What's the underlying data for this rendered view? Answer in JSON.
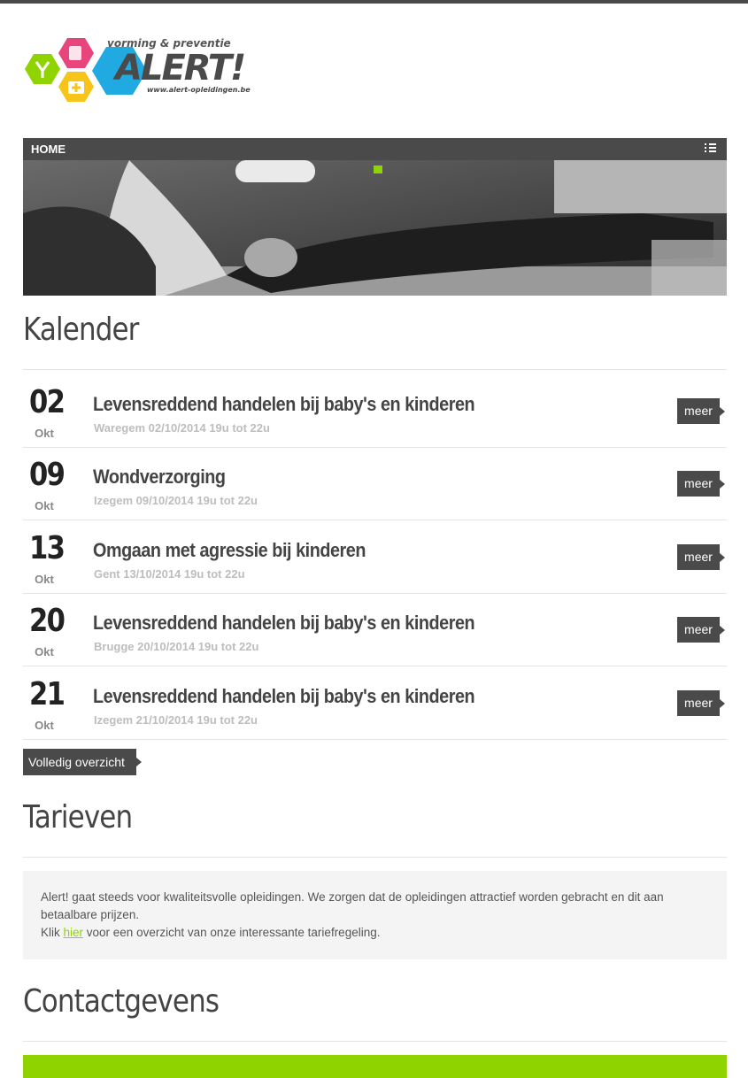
{
  "brand": {
    "tagline": "vorming & preventie",
    "wordmark": "ALERT!",
    "url": "www.alert-opleidingen.be",
    "colors": {
      "green": "#8fd400",
      "pink": "#e8457c",
      "blue": "#21a9e1",
      "yellow": "#f7c41a",
      "dark": "#4a4a4a"
    }
  },
  "nav": {
    "home": "HOME",
    "menu_icon": "list-icon"
  },
  "sections": {
    "kalender": "Kalender",
    "tarieven": "Tarieven",
    "contact": "Contactgevens"
  },
  "events": [
    {
      "day": "02",
      "month": "Okt",
      "title": "Levensreddend handelen bij baby's en kinderen",
      "meta": "Waregem 02/10/2014 19u tot 22u",
      "button": "meer"
    },
    {
      "day": "09",
      "month": "Okt",
      "title": "Wondverzorging",
      "meta": "Izegem 09/10/2014 19u tot 22u",
      "button": "meer"
    },
    {
      "day": "13",
      "month": "Okt",
      "title": "Omgaan met agressie bij kinderen",
      "meta": "Gent 13/10/2014 19u tot 22u",
      "button": "meer"
    },
    {
      "day": "20",
      "month": "Okt",
      "title": "Levensreddend handelen bij baby's en kinderen",
      "meta": "Brugge 20/10/2014 19u tot 22u",
      "button": "meer"
    },
    {
      "day": "21",
      "month": "Okt",
      "title": "Levensreddend handelen bij baby's en kinderen",
      "meta": "Izegem 21/10/2014 19u tot 22u",
      "button": "meer"
    }
  ],
  "overview_button": "Volledig overzicht",
  "tarieven": {
    "line1": "Alert! gaat steeds voor kwaliteitsvolle opleidingen. We zorgen dat de opleidingen attractief worden gebracht en dit aan betaalbare prijzen.",
    "line2_prefix": "Klik ",
    "link": "hier",
    "line2_suffix": " voor een overzicht van onze interessante tariefregeling."
  }
}
